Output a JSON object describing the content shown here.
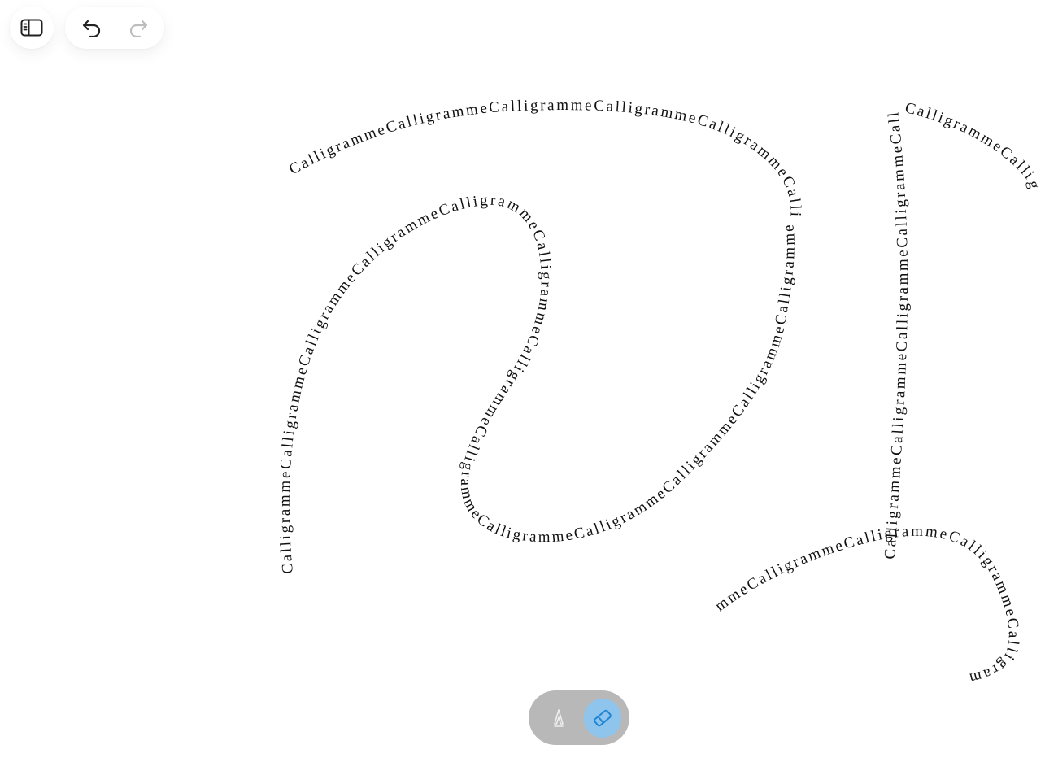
{
  "toolbar_top": {
    "sidebar_toggle_icon": "sidebar-icon",
    "undo_icon": "undo-icon",
    "redo_icon": "redo-icon",
    "redo_enabled": false
  },
  "canvas": {
    "repeated_text": "Calligramme",
    "strokes": [
      {
        "id": "top-arc",
        "text": "CalligrammeCalligrammeCalligrammeCalligrammeCalligrammeCalligrammeCalligrammeCalligramme"
      },
      {
        "id": "big-s",
        "text": "CalligrammeCalligrammeCalligrammeCalligrammeCalligrammeCalligrammeCalligrammeCalligrammeCalligrammeCalligrammeCalligrammeCalligrammeCalligramme"
      },
      {
        "id": "vertical",
        "text": "CalligrammeCalligrammeCalligrammeCalligrammeCalligrammeCalligramme"
      },
      {
        "id": "upper-right",
        "text": "CalligrammeCallig"
      },
      {
        "id": "lower-right",
        "text": "mmeCalligrammeCalligrammeCalligrammeCalligram"
      }
    ]
  },
  "tools": {
    "pen_icon": "pen-icon",
    "eraser_icon": "eraser-icon",
    "active": "eraser",
    "colors": {
      "toolbar_bg": "#b8b8b8",
      "active_bg": "#8fc4ec",
      "active_icon": "#1f86d6",
      "inactive_icon": "#e6e6e6"
    }
  }
}
